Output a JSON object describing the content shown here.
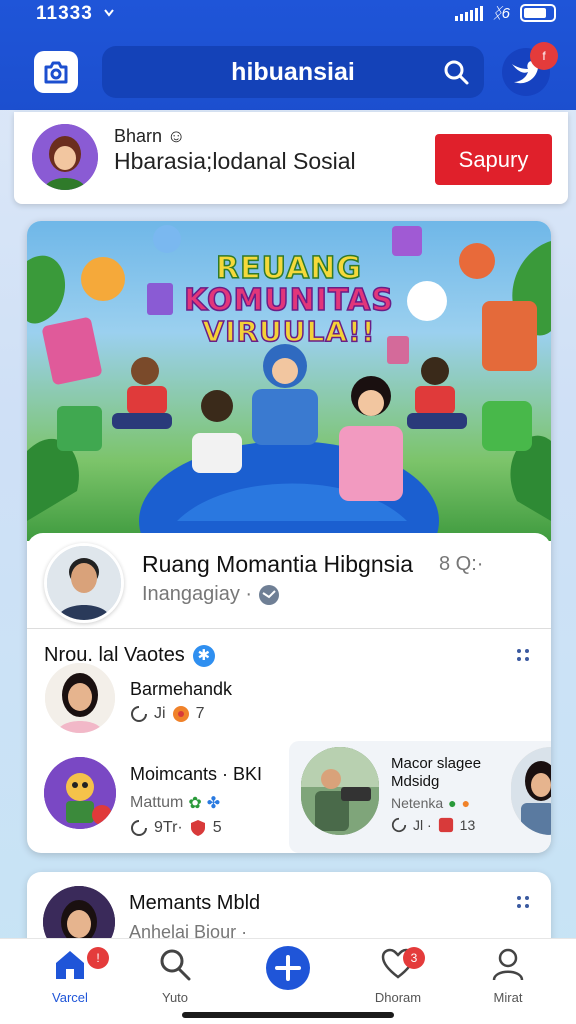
{
  "status_bar": {
    "time": "11333"
  },
  "header": {
    "search_text": "hibuansiai",
    "bird_badge": "f"
  },
  "profile": {
    "name": "Bharn ☺",
    "subtitle": "Hbarasia;lodanal Sosial",
    "follow_label": "Sapury"
  },
  "banner": {
    "line1": "REUANG",
    "line2": "KOMUNITAS",
    "line3": "VIRUULA!!"
  },
  "featured": {
    "title": "Ruang Momantia Hibgnsia",
    "extra": "8 Q:·",
    "subtitle": "Inangagiay ·"
  },
  "list": {
    "heading": "Nrou. lal Vaotes",
    "items": [
      {
        "name": "Barmehandk",
        "likes": "Ji",
        "comments": "7"
      },
      {
        "name": "Moimcants · BKI",
        "sub": "Mattum",
        "likes": "9Tr·",
        "comments": "5"
      }
    ],
    "side": {
      "title": "Macor slagee",
      "line2": "Mdsidg",
      "sub": "Netenka",
      "likes": "Jl ·",
      "comments": "13"
    }
  },
  "card2": {
    "title": "Memants Mbld",
    "subtitle": "Anhelai Biour ·"
  },
  "nav": [
    {
      "label": "Varcel",
      "badge": "!"
    },
    {
      "label": "Yuto"
    },
    {
      "label": ""
    },
    {
      "label": "Dhoram",
      "badge": "3"
    },
    {
      "label": "Mirat"
    }
  ],
  "colors": {
    "header": "#1f55d8",
    "accent_red": "#e0202b",
    "nav_active": "#1f55d8"
  }
}
